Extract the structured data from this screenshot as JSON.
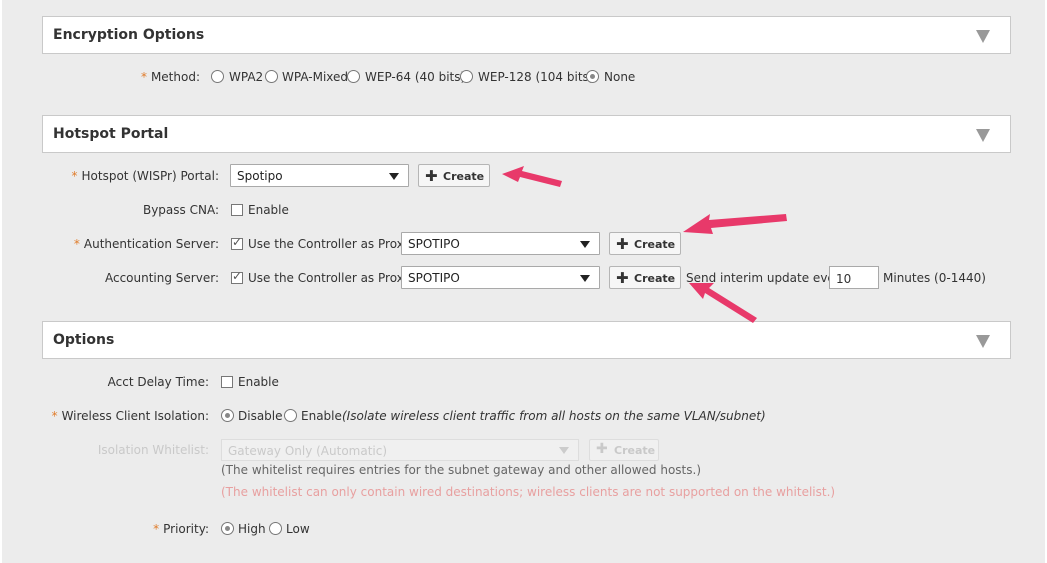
{
  "encryption": {
    "title": "Encryption Options",
    "method_label": "Method:",
    "options": [
      "WPA2",
      "WPA-Mixed",
      "WEP-64 (40 bits)",
      "WEP-128 (104 bits)",
      "None"
    ],
    "selected": "None"
  },
  "hotspot": {
    "title": "Hotspot Portal",
    "portal_label": "Hotspot (WISPr) Portal:",
    "portal_value": "Spotipo",
    "create_label": "Create",
    "bypass_label": "Bypass CNA:",
    "enable_label": "Enable",
    "auth_label": "Authentication Server:",
    "proxy_label": "Use the Controller as Proxy",
    "auth_value": "SPOTIPO",
    "acct_label": "Accounting Server:",
    "acct_value": "SPOTIPO",
    "interim_label": "Send interim update every",
    "interim_value": "10",
    "interim_unit": "Minutes (0-1440)"
  },
  "options": {
    "title": "Options",
    "acct_delay_label": "Acct Delay Time:",
    "enable_label": "Enable",
    "isolation_label": "Wireless Client Isolation:",
    "disable_label": "Disable",
    "isolation_enable_label": "Enable",
    "isolation_note": "(Isolate wireless client traffic from all hosts on the same VLAN/subnet)",
    "whitelist_label": "Isolation Whitelist:",
    "whitelist_value": "Gateway Only (Automatic)",
    "whitelist_create": "Create",
    "whitelist_note1": "(The whitelist requires entries for the subnet gateway and other allowed hosts.)",
    "whitelist_note2": "(The whitelist can only contain wired destinations; wireless clients are not supported on the whitelist.)",
    "priority_label": "Priority:",
    "high_label": "High",
    "low_label": "Low"
  },
  "colors": {
    "required": "#e07c2a",
    "arrow": "#e8396a",
    "warning_text": "#e8a0a0"
  }
}
